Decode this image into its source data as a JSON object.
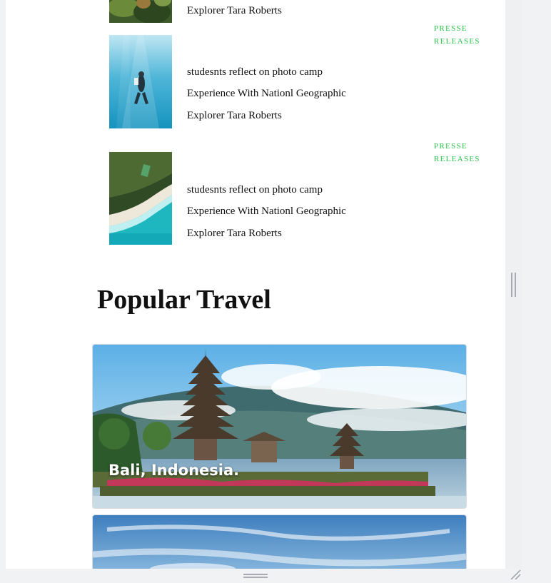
{
  "news_items": [
    {
      "lines": [
        "Explorer Tara Roberts"
      ]
    },
    {
      "tag": "PRESSE RELEASES",
      "lines": [
        "studesnts reflect on photo camp",
        "Experience With Nationl Geographic",
        "Explorer Tara Roberts"
      ]
    },
    {
      "tag": "PRESSE RELEASES",
      "lines": [
        "studesnts reflect on photo camp",
        "Experience With Nationl Geographic",
        "Explorer Tara Roberts"
      ]
    }
  ],
  "popular": {
    "heading": "Popular Travel",
    "cards": [
      {
        "caption": "Bali, Indonesia."
      },
      {
        "caption": ""
      }
    ]
  },
  "colors": {
    "tag_green": "#27c24a"
  }
}
